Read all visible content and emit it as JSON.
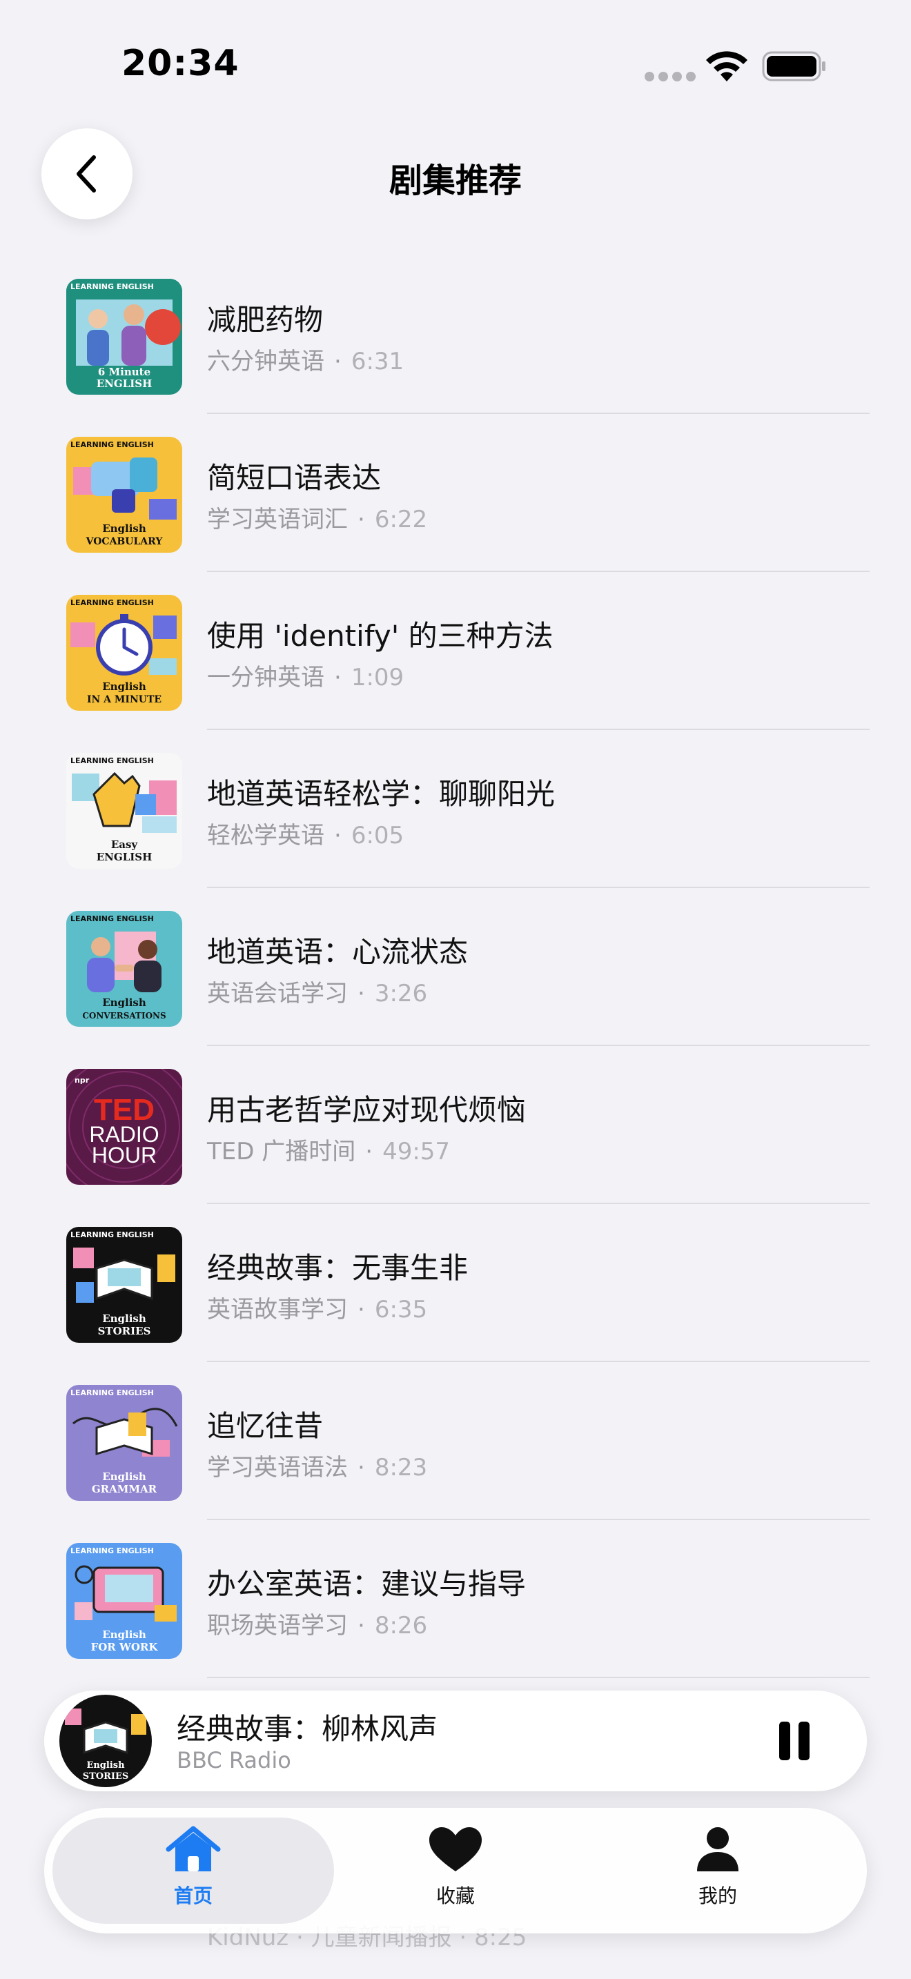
{
  "status_bar": {
    "time": "20:34"
  },
  "header": {
    "title": "剧集推荐"
  },
  "episodes": [
    {
      "title": "减肥药物",
      "show": "六分钟英语",
      "duration": "6:31",
      "thumb_label_1": "6 Minute",
      "thumb_label_2": "ENGLISH",
      "thumb_brand": "LEARNING ENGLISH"
    },
    {
      "title": "简短口语表达",
      "show": "学习英语词汇",
      "duration": "6:22",
      "thumb_label_1": "English",
      "thumb_label_2": "VOCABULARY",
      "thumb_brand": "LEARNING ENGLISH"
    },
    {
      "title": "使用 'identify' 的三种方法",
      "show": "一分钟英语",
      "duration": "1:09",
      "thumb_label_1": "English",
      "thumb_label_2": "IN A MINUTE",
      "thumb_brand": "LEARNING ENGLISH"
    },
    {
      "title": "地道英语轻松学：聊聊阳光",
      "show": "轻松学英语",
      "duration": "6:05",
      "thumb_label_1": "Easy",
      "thumb_label_2": "ENGLISH",
      "thumb_brand": "LEARNING ENGLISH"
    },
    {
      "title": "地道英语：心流状态",
      "show": "英语会话学习",
      "duration": "3:26",
      "thumb_label_1": "English",
      "thumb_label_2": "CONVERSATIONS",
      "thumb_brand": "LEARNING ENGLISH"
    },
    {
      "title": "用古老哲学应对现代烦恼",
      "show": "TED 广播时间",
      "duration": "49:57",
      "thumb_label_1": "TED",
      "thumb_label_2": "RADIO",
      "thumb_label_3": "HOUR",
      "thumb_brand": "npr"
    },
    {
      "title": "经典故事：无事生非",
      "show": "英语故事学习",
      "duration": "6:35",
      "thumb_label_1": "English",
      "thumb_label_2": "STORIES",
      "thumb_brand": "LEARNING ENGLISH"
    },
    {
      "title": "追忆往昔",
      "show": "学习英语语法",
      "duration": "8:23",
      "thumb_label_1": "English",
      "thumb_label_2": "GRAMMAR",
      "thumb_brand": "LEARNING ENGLISH"
    },
    {
      "title": "办公室英语：建议与指导",
      "show": "职场英语学习",
      "duration": "8:26",
      "thumb_label_1": "English",
      "thumb_label_2": "FOR WORK",
      "thumb_brand": "LEARNING ENGLISH"
    }
  ],
  "hidden_row": {
    "show": "KidNuz · 儿童新闻播报",
    "duration": "8:25"
  },
  "now_playing": {
    "title": "经典故事：柳林风声",
    "subtitle": "BBC Radio",
    "art_label_1": "English",
    "art_label_2": "STORIES"
  },
  "tabs": [
    {
      "label": "首页",
      "icon": "house-icon",
      "active": true
    },
    {
      "label": "收藏",
      "icon": "heart-icon",
      "active": false
    },
    {
      "label": "我的",
      "icon": "person-icon",
      "active": false
    }
  ],
  "colors": {
    "accent": "#1d7cf2",
    "background": "#f2f2f7",
    "thumb_bg": [
      "#1f8f7e",
      "#f6c03b",
      "#f6c03b",
      "#f4f4f4",
      "#5bbec8",
      "#7a1f5e",
      "#111111",
      "#8e84cf",
      "#5a9cf0"
    ]
  }
}
